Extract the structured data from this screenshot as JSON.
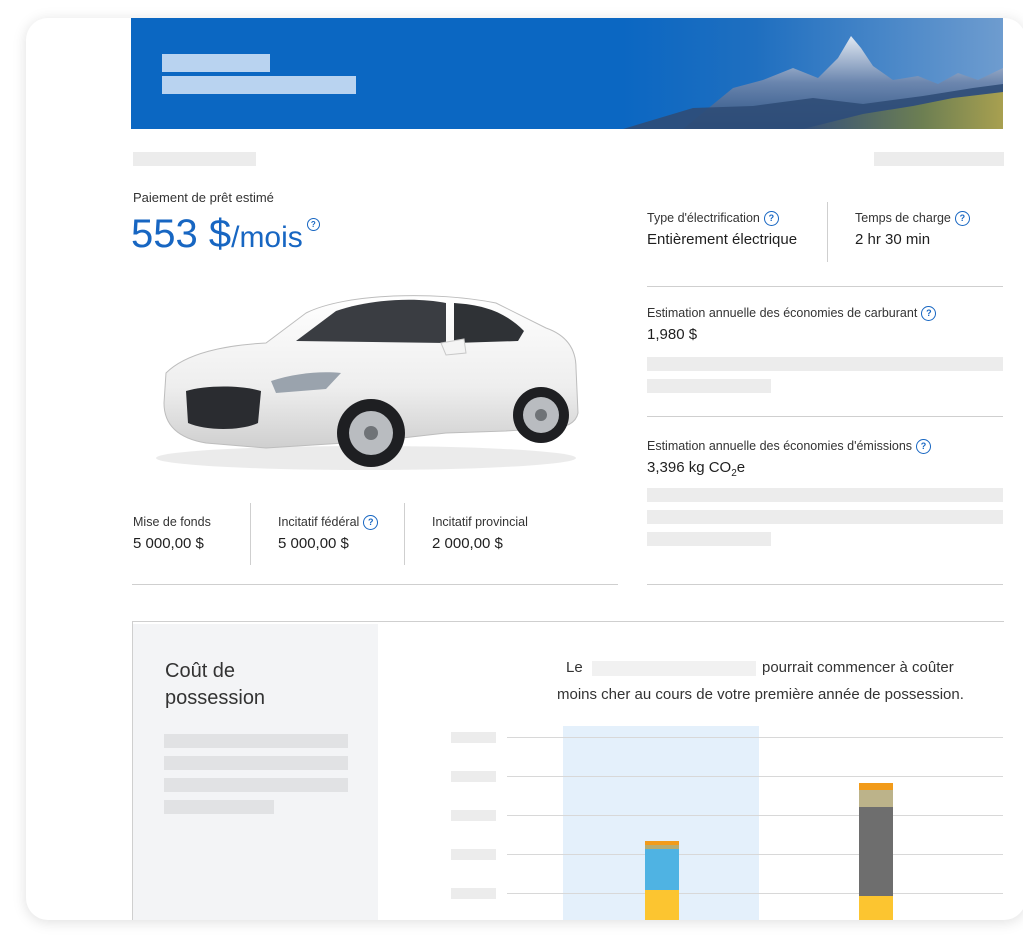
{
  "loan": {
    "label": "Paiement de prêt estimé",
    "amount": "553 $",
    "unit": "/mois"
  },
  "specs": {
    "electrification": {
      "label": "Type d'électrification",
      "value": "Entièrement électrique"
    },
    "charge_time": {
      "label": "Temps de charge",
      "value": "2 hr 30 min"
    },
    "fuel_savings": {
      "label": "Estimation annuelle des économies de carburant",
      "value": "1,980 $"
    },
    "emission_savings": {
      "label": "Estimation annuelle des économies d'émissions",
      "value": "3,396 kg CO",
      "subscript": "2",
      "value_suffix": "e"
    }
  },
  "incentives": {
    "down_payment": {
      "label": "Mise de fonds",
      "value": "5 000,00 $"
    },
    "federal": {
      "label": "Incitatif fédéral",
      "value": "5 000,00 $"
    },
    "provincial": {
      "label": "Incitatif provincial",
      "value": "2 000,00 $"
    }
  },
  "ownership": {
    "title_line1": "Coût de",
    "title_line2": "possession",
    "statement_prefix": "Le",
    "statement_line1_suffix": "pourrait commencer à coûter",
    "statement_line2": "moins cher au cours de votre première année de possession."
  },
  "colors": {
    "brand_blue": "#0b67c2",
    "price_blue": "#1766c2",
    "highlight": "#e4f0fb",
    "bar_yellow": "#fcc530",
    "bar_blue": "#4fb3e3",
    "bar_orange": "#f29b1a",
    "bar_gray": "#6e6e6e",
    "bar_tan": "#bcb38a"
  },
  "icons": [
    "help-icon",
    "car-image",
    "mountain-banner"
  ]
}
